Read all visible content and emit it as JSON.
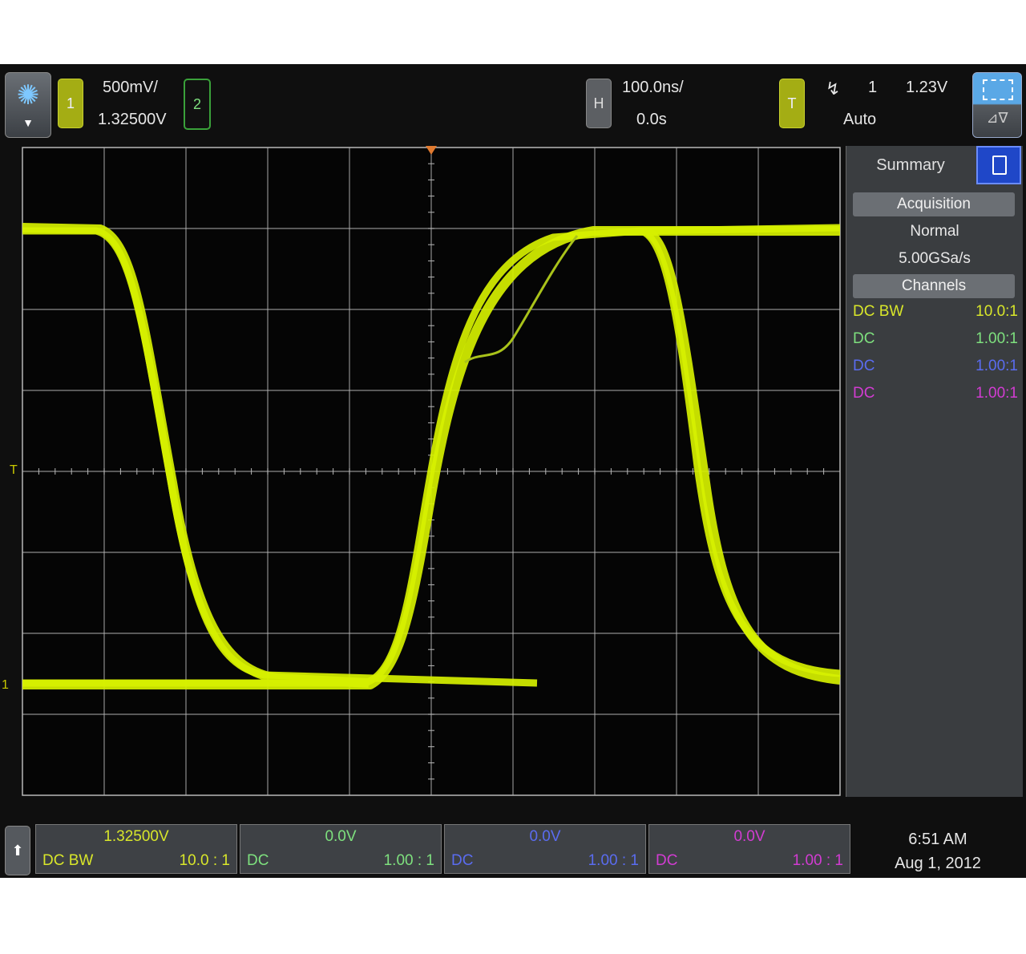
{
  "colors": {
    "ch1": "#d8e62a",
    "ch2": "#7ee07e",
    "ch3": "#5a6cf0",
    "ch4": "#d23cd2",
    "grid": "#b8b8b8",
    "trace": "#d6f000",
    "trace_dim": "#a9c21a"
  },
  "topbar": {
    "ch1_label": "1",
    "ch1_scale": "500mV/",
    "ch1_offset": "1.32500V",
    "ch2_label": "2",
    "horiz_label": "H",
    "timebase": "100.0ns/",
    "delay": "0.0s",
    "trigger_label": "T",
    "trigger_source": "1",
    "trigger_level": "1.23V",
    "trigger_mode": "Auto"
  },
  "grid": {
    "markers": {
      "trigger_level": "T",
      "ch1_ground": "1"
    }
  },
  "side_panel": {
    "tab": "Summary",
    "acquisition_header": "Acquisition",
    "acq_mode": "Normal",
    "sample_rate": "5.00GSa/s",
    "channels_header": "Channels",
    "channels": [
      {
        "coupling": "DC  BW",
        "probe": "10.0:1",
        "color": "#d8e62a"
      },
      {
        "coupling": "DC",
        "probe": "1.00:1",
        "color": "#7ee07e"
      },
      {
        "coupling": "DC",
        "probe": "1.00:1",
        "color": "#5a6cf0"
      },
      {
        "coupling": "DC",
        "probe": "1.00:1",
        "color": "#d23cd2"
      }
    ]
  },
  "bottombar": {
    "cells": [
      {
        "offset": "1.32500V",
        "coupling": "DC   BW",
        "probe": "10.0 : 1",
        "color": "#d8e62a"
      },
      {
        "offset": "0.0V",
        "coupling": "DC",
        "probe": "1.00 : 1",
        "color": "#7ee07e"
      },
      {
        "offset": "0.0V",
        "coupling": "DC",
        "probe": "1.00 : 1",
        "color": "#5a6cf0"
      },
      {
        "offset": "0.0V",
        "coupling": "DC",
        "probe": "1.00 : 1",
        "color": "#d23cd2"
      }
    ],
    "time": "6:51 AM",
    "date": "Aug 1, 2012"
  }
}
